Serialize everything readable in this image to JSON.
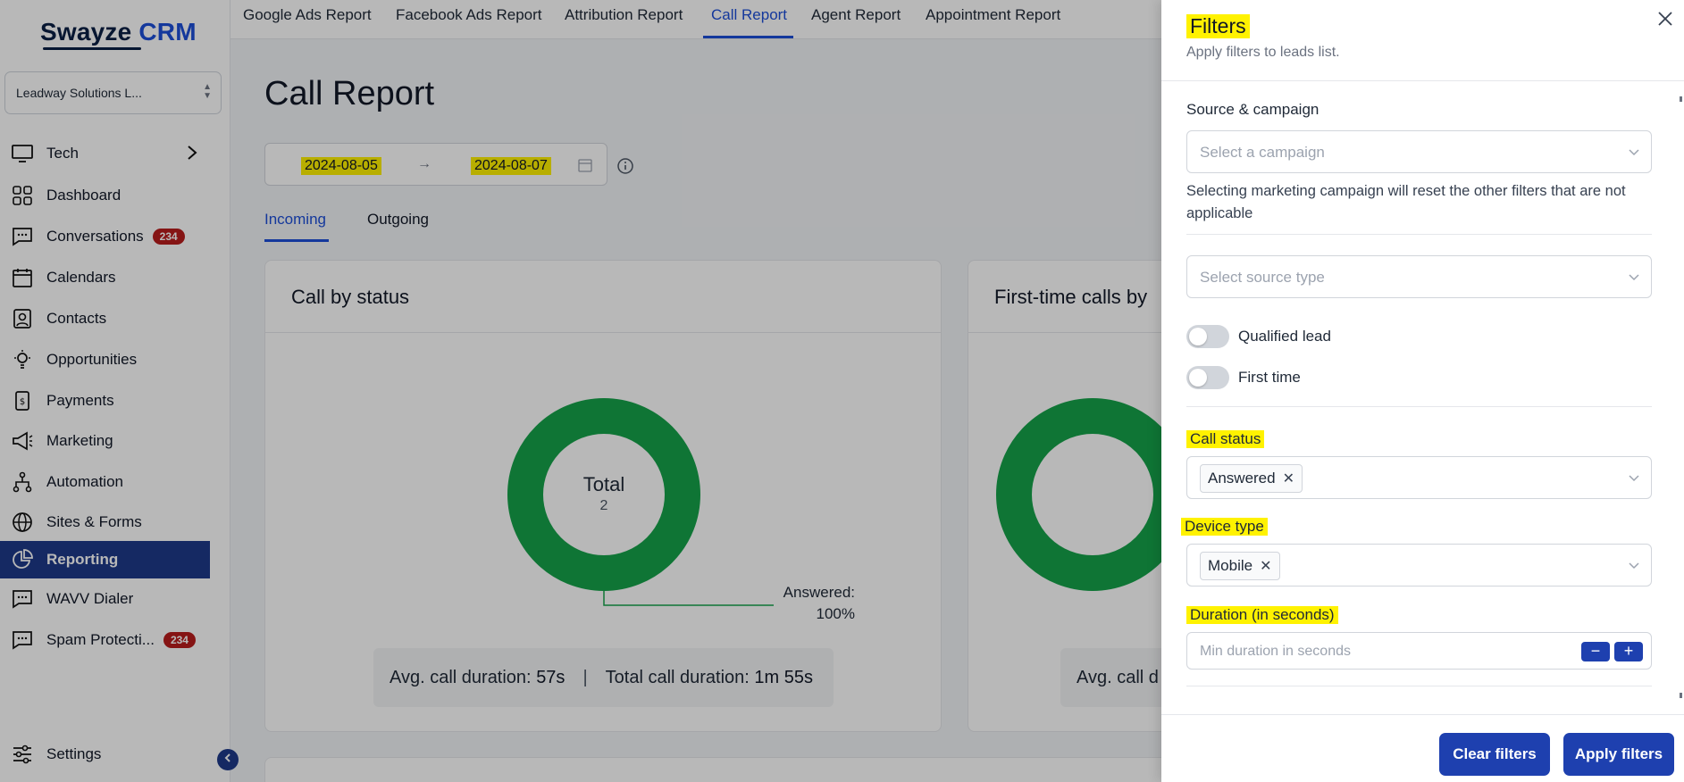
{
  "sidebar": {
    "logo_part1": "Swayze",
    "logo_part2": "CRM",
    "account_name": "Leadway Solutions L...",
    "items": [
      {
        "label": "Tech",
        "icon": "monitor-icon"
      },
      {
        "label": "Dashboard",
        "icon": "dashboard-grid-icon"
      },
      {
        "label": "Conversations",
        "icon": "chat-icon",
        "badge": "234"
      },
      {
        "label": "Calendars",
        "icon": "calendar-icon"
      },
      {
        "label": "Contacts",
        "icon": "contact-card-icon"
      },
      {
        "label": "Opportunities",
        "icon": "lightbulb-icon"
      },
      {
        "label": "Payments",
        "icon": "payment-icon"
      },
      {
        "label": "Marketing",
        "icon": "megaphone-icon"
      },
      {
        "label": "Automation",
        "icon": "workflow-icon"
      },
      {
        "label": "Sites & Forms",
        "icon": "globe-icon"
      },
      {
        "label": "Reporting",
        "icon": "pie-chart-icon"
      },
      {
        "label": "WAVV Dialer",
        "icon": "chat-icon"
      },
      {
        "label": "Spam Protecti...",
        "icon": "chat-icon",
        "badge": "234"
      }
    ],
    "settings_label": "Settings"
  },
  "top_tabs": [
    "Google Ads Report",
    "Facebook Ads Report",
    "Attribution Report",
    "Call Report",
    "Agent Report",
    "Appointment Report"
  ],
  "main": {
    "title": "Call Report",
    "date_start": "2024-08-05",
    "date_end": "2024-08-07",
    "date_arrow": "→",
    "sub_tabs": [
      "Incoming",
      "Outgoing"
    ],
    "card1": {
      "title": "Call by status",
      "donut_center_label": "Total",
      "donut_center_value": "2",
      "slice_label": "Answered:",
      "slice_pct": "100%",
      "avg_label": "Avg. call duration:",
      "avg_value": "57s",
      "sep": "|",
      "total_label": "Total call duration:",
      "total_value": "1m 55s"
    },
    "card2": {
      "title": "First-time calls by",
      "avg_label": "Avg. call d"
    }
  },
  "chart_data": {
    "type": "pie",
    "title": "Call by status",
    "categories": [
      "Answered"
    ],
    "values": [
      100
    ],
    "total": 2,
    "colors": [
      "#16a34a"
    ]
  },
  "drawer": {
    "title": "Filters",
    "subtitle": "Apply filters to leads list.",
    "source_label": "Source & campaign",
    "campaign_placeholder": "Select a campaign",
    "help_text": "Selecting marketing campaign will reset the other filters that are not applicable",
    "source_type_placeholder": "Select source type",
    "qualified_label": "Qualified lead",
    "first_time_label": "First time",
    "call_status_label": "Call status",
    "call_status_chip": "Answered",
    "device_type_label": "Device type",
    "device_type_chip": "Mobile",
    "duration_label": "Duration (in seconds)",
    "duration_placeholder": "Min duration in seconds",
    "minus": "−",
    "plus": "+",
    "clear_label": "Clear filters",
    "apply_label": "Apply filters"
  },
  "colors": {
    "accent": "#1d4ed8",
    "sidebar_active": "#1e3a8a",
    "badge": "#b91c1c",
    "donut": "#16a34a",
    "highlight": "#fff200"
  }
}
